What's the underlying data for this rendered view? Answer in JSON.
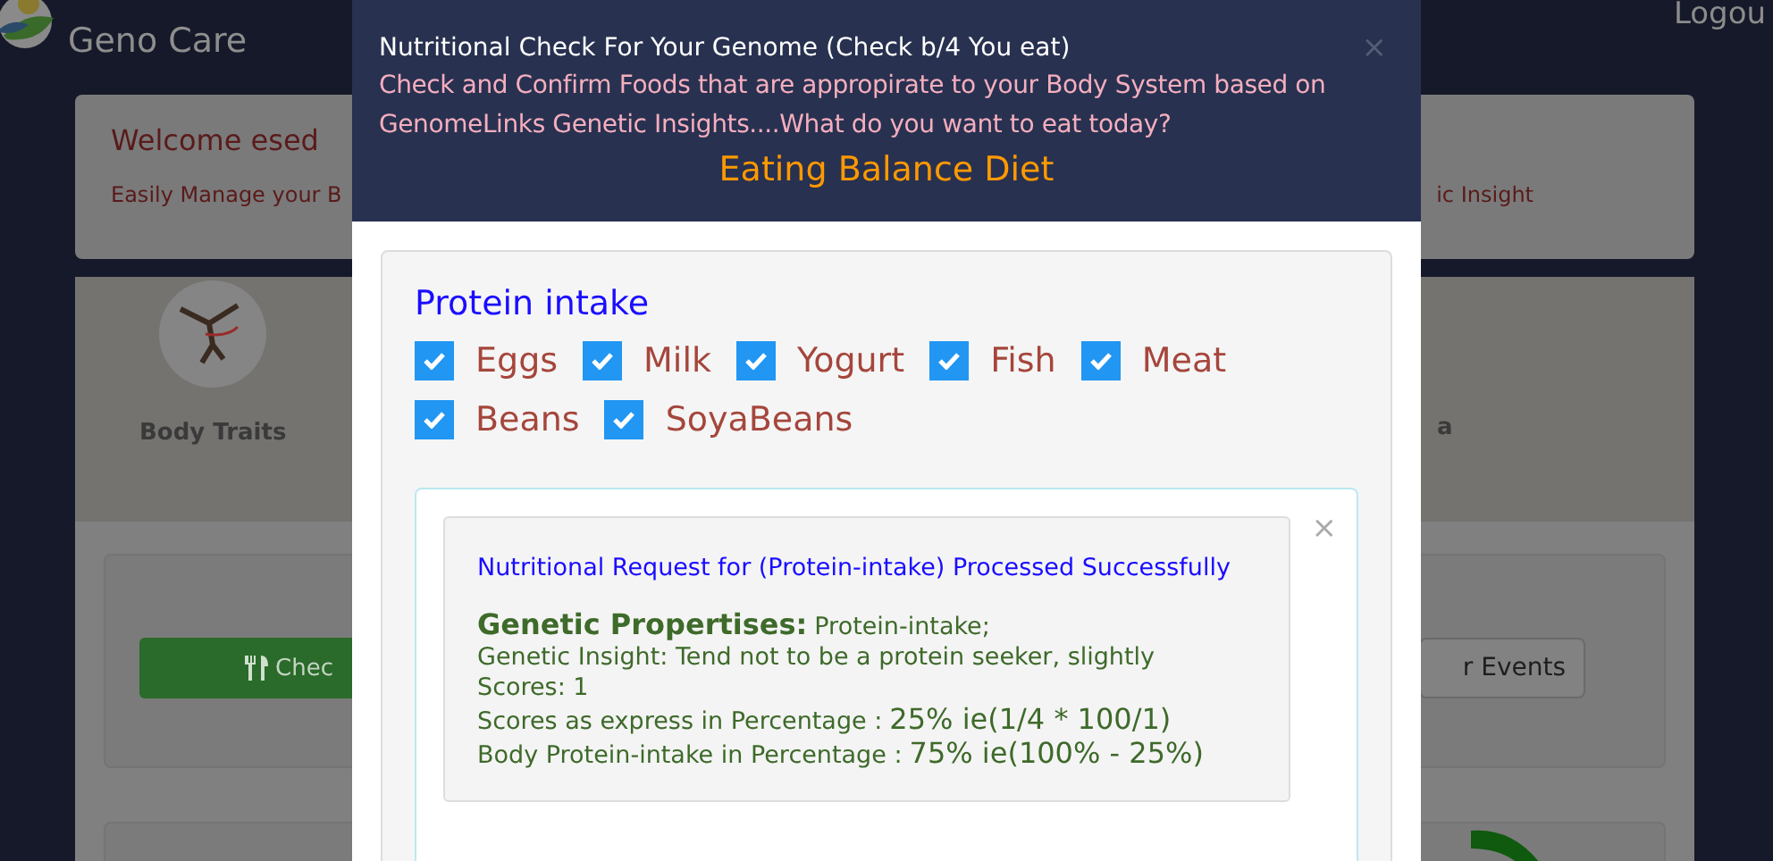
{
  "header": {
    "brand": "Geno Care",
    "logout": "Logou"
  },
  "welcome": {
    "title": "Welcome esed",
    "subtitle_left": "Easily Manage your B",
    "subtitle_right": "ic Insight"
  },
  "features": [
    {
      "label": "Body Traits",
      "kind": "icon"
    },
    {
      "label": "a",
      "kind": "plain"
    }
  ],
  "actions": {
    "left_button": "Chec",
    "right_button": "r Events"
  },
  "modal": {
    "title": "Nutritional Check For Your Genome (Check b/4 You eat)",
    "description_lines": [
      "Check and Confirm Foods that are appropirate to your Body System based on",
      "GenomeLinks Genetic Insights....What do you want to eat today?"
    ],
    "subtitle": "Eating Balance Diet",
    "close": "×",
    "section_title": "Protein intake",
    "foods": [
      {
        "label": "Eggs",
        "checked": true
      },
      {
        "label": "Milk",
        "checked": true
      },
      {
        "label": "Yogurt",
        "checked": true
      },
      {
        "label": "Fish",
        "checked": true
      },
      {
        "label": "Meat",
        "checked": true
      },
      {
        "label": "Beans",
        "checked": true
      },
      {
        "label": "SoyaBeans",
        "checked": true
      }
    ],
    "result": {
      "close": "×",
      "message": "Nutritional Request for (Protein-intake) Processed Successfully",
      "lines": [
        {
          "kind": "heading",
          "label": "Genetic Propertises:",
          "value": "Protein-intake;"
        },
        {
          "kind": "text",
          "label": "Genetic Insight: Tend not to be a protein seeker, slightly"
        },
        {
          "kind": "text",
          "label": "Scores: 1"
        },
        {
          "kind": "emphasis",
          "label": "Scores as express in Percentage :",
          "value": "25% ie(1/4 * 100/1)"
        },
        {
          "kind": "emphasis",
          "label": "Body Protein-intake in Percentage :",
          "value": "75% ie(100% - 25%)"
        }
      ]
    }
  }
}
